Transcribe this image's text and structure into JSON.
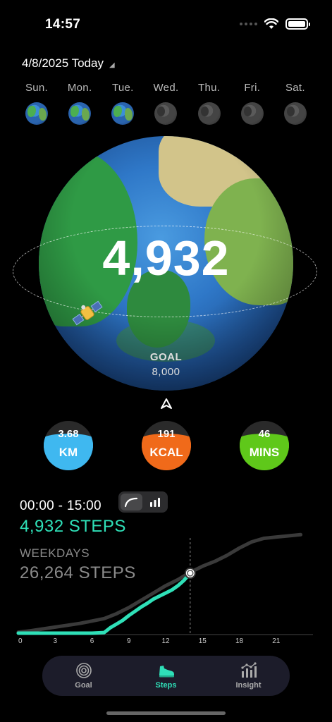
{
  "status": {
    "time": "14:57"
  },
  "date": {
    "label": "4/8/2025 Today"
  },
  "week": [
    {
      "label": "Sun.",
      "reached": true
    },
    {
      "label": "Mon.",
      "reached": true
    },
    {
      "label": "Tue.",
      "reached": true
    },
    {
      "label": "Wed.",
      "reached": false
    },
    {
      "label": "Thu.",
      "reached": false
    },
    {
      "label": "Fri.",
      "reached": false
    },
    {
      "label": "Sat.",
      "reached": false
    }
  ],
  "summary": {
    "steps": "4,932",
    "goal_label": "GOAL",
    "goal_value": "8,000"
  },
  "metrics": [
    {
      "value": "3.68",
      "unit": "KM",
      "color": "#3fb8f0"
    },
    {
      "value": "191",
      "unit": "KCAL",
      "color": "#f06a1a"
    },
    {
      "value": "46",
      "unit": "MINS",
      "color": "#5fc81a"
    }
  ],
  "steps_section": {
    "time_range": "00:00 - 15:00",
    "today_steps": "4,932 STEPS",
    "weekday_label": "WEEKDAYS",
    "weekday_steps": "26,264 STEPS"
  },
  "chart_data": {
    "type": "line",
    "x_ticks": [
      "0",
      "3",
      "6",
      "9",
      "12",
      "15",
      "18",
      "21"
    ],
    "xlim": [
      0,
      24
    ],
    "ylim": [
      0,
      8000
    ],
    "current_hour": 14,
    "series": [
      {
        "color": "#3a3a3a",
        "x": [
          0,
          1,
          2,
          3,
          4,
          5,
          6,
          7,
          8,
          9,
          10,
          11,
          12,
          13,
          14,
          15,
          16,
          17,
          18,
          19,
          20,
          21,
          22,
          23
        ],
        "values": [
          80,
          200,
          350,
          500,
          650,
          800,
          1000,
          1200,
          1600,
          2100,
          2700,
          3300,
          3900,
          4400,
          5000,
          5500,
          5900,
          6400,
          7000,
          7500,
          7800,
          7900,
          8000,
          8100
        ]
      },
      {
        "color": "#2fe0b8",
        "x": [
          0,
          1,
          2,
          3,
          4,
          5,
          6,
          7,
          7.5,
          8,
          8.5,
          9,
          9.5,
          10,
          10.5,
          11,
          11.5,
          12,
          12.5,
          13,
          13.5,
          14
        ],
        "values": [
          0,
          0,
          0,
          0,
          0,
          0,
          0,
          50,
          450,
          750,
          1050,
          1450,
          1800,
          2150,
          2450,
          2800,
          3050,
          3300,
          3550,
          3900,
          4350,
          4932
        ]
      }
    ]
  },
  "tabs": [
    {
      "label": "Goal",
      "icon": "target-icon",
      "active": false
    },
    {
      "label": "Steps",
      "icon": "sneaker-icon",
      "active": true
    },
    {
      "label": "Insight",
      "icon": "bar-chart-icon",
      "active": false
    }
  ]
}
